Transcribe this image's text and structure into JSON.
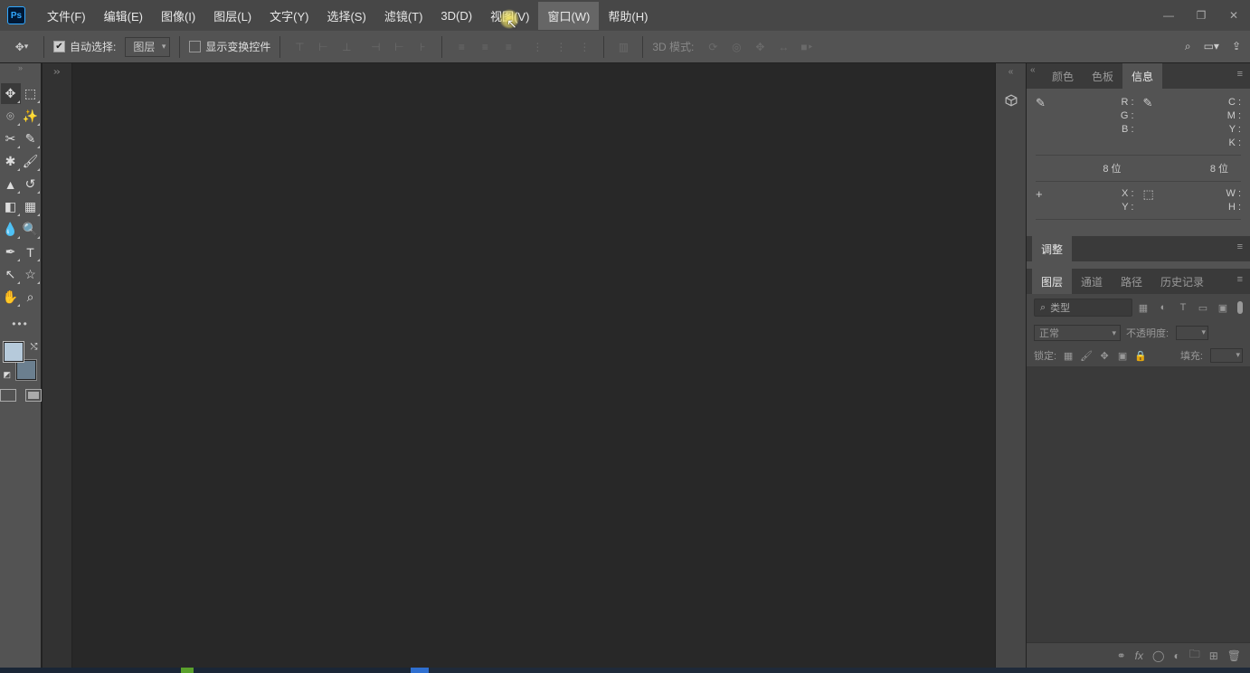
{
  "app": {
    "logo": "Ps"
  },
  "menu": {
    "file": "文件(F)",
    "edit": "编辑(E)",
    "image": "图像(I)",
    "layer": "图层(L)",
    "type": "文字(Y)",
    "select": "选择(S)",
    "filter": "滤镜(T)",
    "threeD": "3D(D)",
    "view": "视图(V)",
    "window": "窗口(W)",
    "help": "帮助(H)"
  },
  "options": {
    "autoSelect": "自动选择:",
    "target": "图层",
    "showTransform": "显示变换控件",
    "threeDMode": "3D 模式:"
  },
  "panels": {
    "color": "颜色",
    "swatches": "色板",
    "info": "信息",
    "adjust": "调整",
    "layers": "图层",
    "channels": "通道",
    "paths": "路径",
    "history": "历史记录"
  },
  "info": {
    "r": "R :",
    "g": "G :",
    "b": "B :",
    "c": "C :",
    "m": "M :",
    "y": "Y :",
    "k": "K :",
    "bit8a": "8 位",
    "bit8b": "8 位",
    "x": "X :",
    "yv": "Y :",
    "w": "W :",
    "h": "H :"
  },
  "layersPanel": {
    "searchLabel": "类型",
    "mode": "正常",
    "opacityLabel": "不透明度:",
    "lockLabel": "锁定:",
    "fillLabel": "填充:"
  }
}
